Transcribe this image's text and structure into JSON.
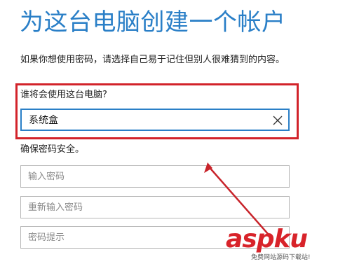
{
  "page": {
    "title": "为这台电脑创建一个帐户",
    "intro": "如果你想使用密码，请选择自己易于记住但别人很难猜到的内容。"
  },
  "account": {
    "who_label": "谁将会使用这台电脑?",
    "username_value": "系统盒",
    "clear_icon": "close-icon"
  },
  "security": {
    "label": "确保密码安全。",
    "password_placeholder": "输入密码",
    "reenter_placeholder": "重新输入密码",
    "hint_placeholder": "密码提示"
  },
  "watermark": {
    "logo": "aspku",
    "sub": "免费网站源码下载站!"
  },
  "colors": {
    "title": "#2a7fc7",
    "highlight": "#d2232a",
    "focus_border": "#2a7fc7",
    "watermark": "#d8232a"
  }
}
